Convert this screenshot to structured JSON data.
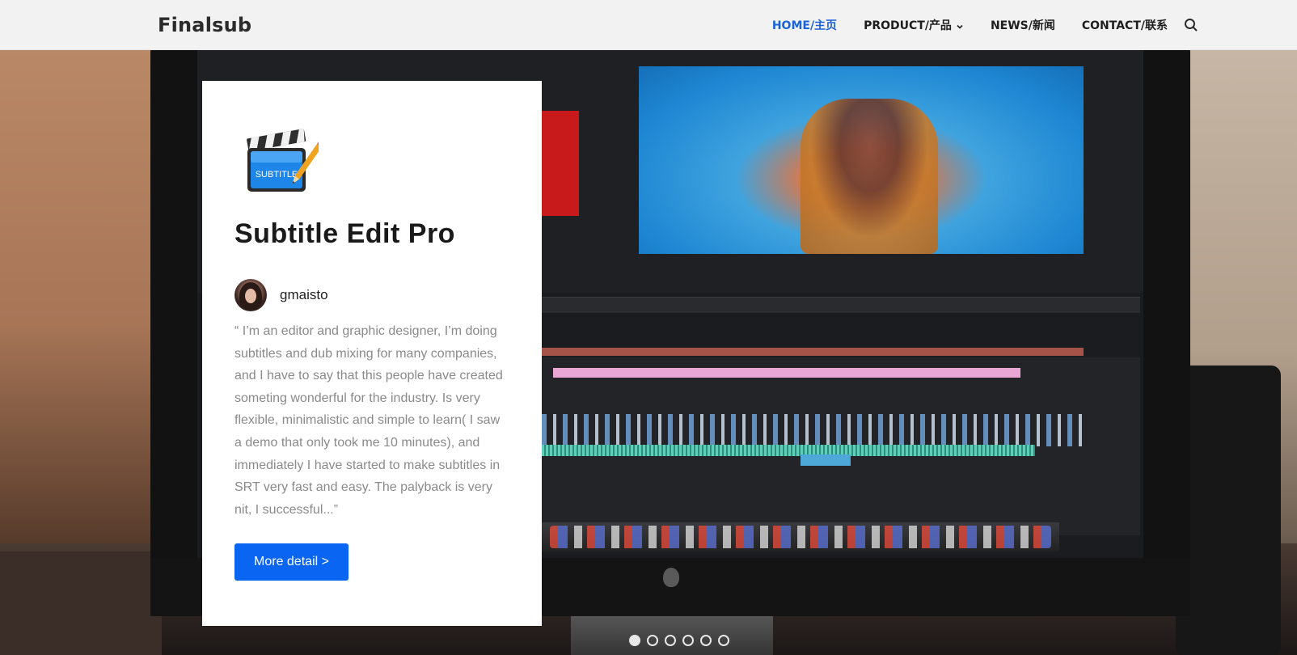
{
  "header": {
    "logo": "Finalsub",
    "nav": [
      {
        "label": "HOME/主页",
        "active": true
      },
      {
        "label": "PRODUCT/产品",
        "has_dropdown": true
      },
      {
        "label": "NEWS/新闻"
      },
      {
        "label": "CONTACT/联系"
      }
    ],
    "search_icon": "search-icon"
  },
  "slide": {
    "app_icon": "clapperboard-subtitle-icon",
    "app_icon_text": "SUBTITLE",
    "title": "Subtitle Edit Pro",
    "author": "gmaisto",
    "quote": "“ I’m an editor and graphic designer, I’m doing subtitles and dub mixing for many companies, and I have to say that this people have created someting wonderful for the industry. Is very flexible, minimalistic and simple to learn( I saw a demo that only took me 10 minutes), and immediately I have started to make subtitles in SRT very fast and easy. The palyback is very nit, I successful...”",
    "button_label": "More detail >"
  },
  "pager": {
    "count": 6,
    "active_index": 0
  },
  "colors": {
    "accent": "#0a66f2",
    "nav_active": "#1b62d8",
    "header_bg": "#f2f2f2"
  }
}
